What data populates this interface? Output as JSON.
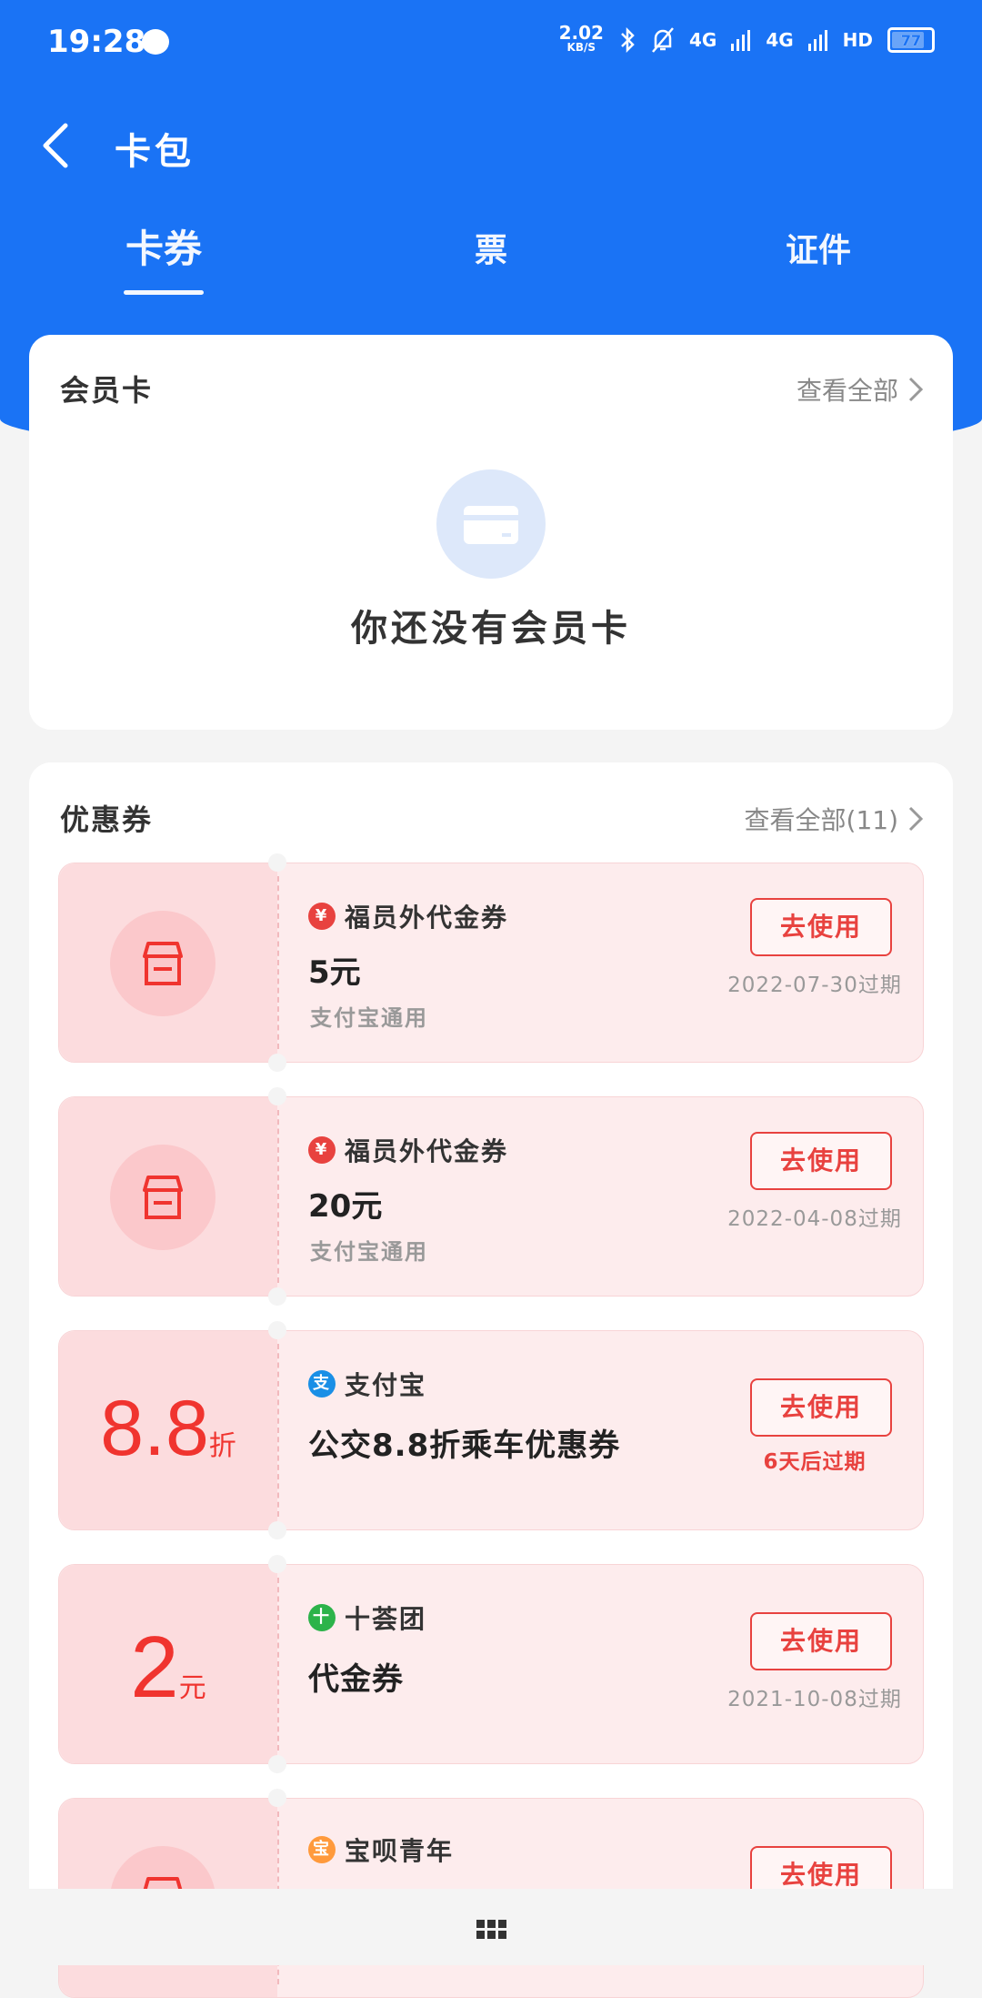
{
  "status": {
    "time": "19:28",
    "speed": "2.02",
    "speed_unit": "KB/S",
    "net1": "4G",
    "net2": "4G",
    "hd": "HD",
    "battery": "77"
  },
  "nav": {
    "title": "卡包"
  },
  "tabs": [
    {
      "label": "卡券",
      "active": true
    },
    {
      "label": "票"
    },
    {
      "label": "证件"
    }
  ],
  "membership": {
    "title": "会员卡",
    "more": "查看全部",
    "empty_text": "你还没有会员卡"
  },
  "coupons_section": {
    "title": "优惠券",
    "more": "查看全部(11)"
  },
  "coupons": [
    {
      "brand": "福员外代金券",
      "name": "5元",
      "sub": "支付宝通用",
      "button": "去使用",
      "expire": "2022-07-30过期"
    },
    {
      "brand": "福员外代金券",
      "name": "20元",
      "sub": "支付宝通用",
      "button": "去使用",
      "expire": "2022-04-08过期"
    },
    {
      "value": "8.8",
      "unit": "折",
      "brand": "支付宝",
      "name": "公交8.8折乘车优惠券",
      "button": "去使用",
      "expire": "6天后过期"
    },
    {
      "value": "2",
      "unit": "元",
      "brand": "十荟团",
      "name": "代金券",
      "button": "去使用",
      "expire": "2021-10-08过期"
    },
    {
      "brand": "宝呗青年",
      "button": "去使用"
    }
  ],
  "colors": {
    "primary": "#1a73f5",
    "accent": "#e8423f"
  }
}
